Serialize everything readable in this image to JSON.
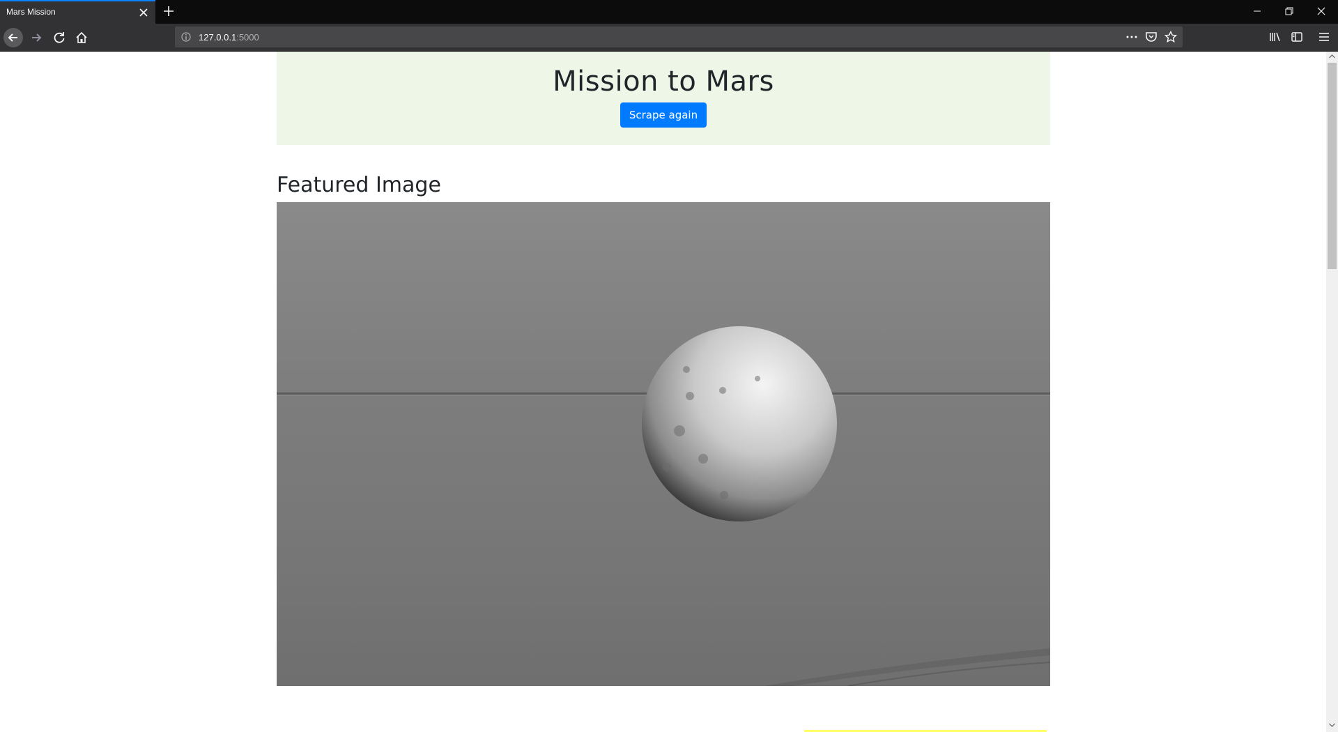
{
  "browser": {
    "tab_title": "Mars Mission",
    "url_host": "127.0.0.1",
    "url_port": ":5000"
  },
  "page": {
    "title": "Mission to Mars",
    "scrape_button": "Scrape again",
    "featured_heading": "Featured Image"
  },
  "icons": [
    "close-icon",
    "plus-icon",
    "minimize-icon",
    "restore-icon",
    "back-icon",
    "forward-icon",
    "reload-icon",
    "home-icon",
    "info-icon",
    "more-icon",
    "pocket-icon",
    "bookmark-star-icon",
    "library-icon",
    "sidebar-icon",
    "menu-icon"
  ],
  "colors": {
    "jumbotron_bg": "#eef6e8",
    "button_bg": "#007bff",
    "tab_accent": "#0a84ff"
  }
}
